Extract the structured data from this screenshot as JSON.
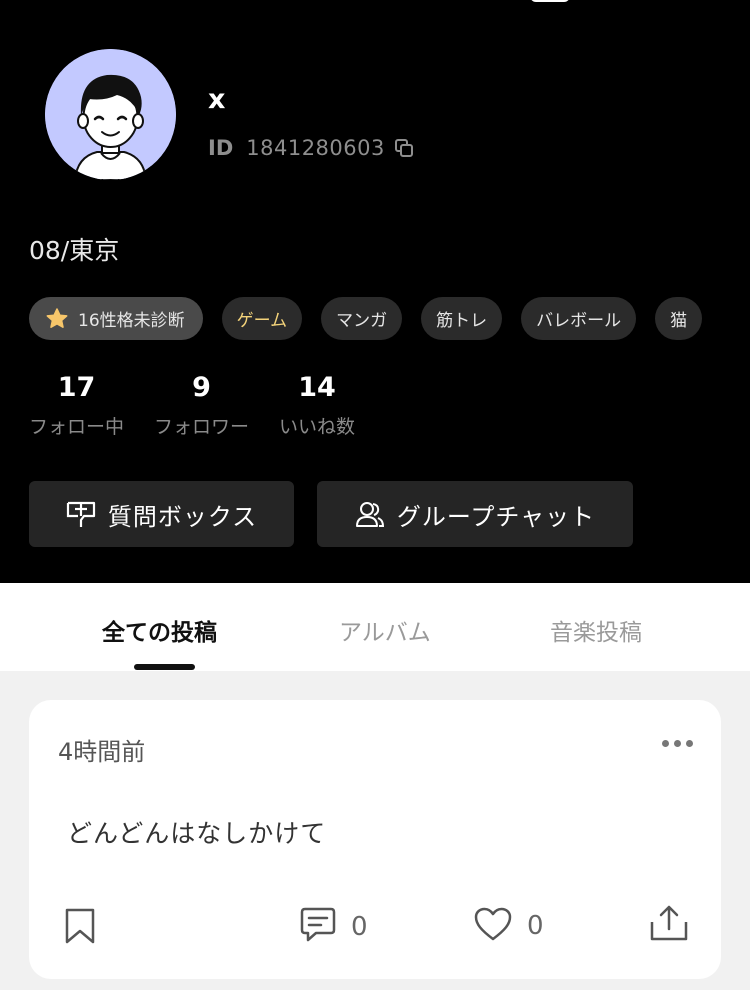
{
  "profile": {
    "username": "x",
    "id_label": "ID",
    "id_number": "1841280603",
    "bio": "08/東京",
    "tags": [
      {
        "label": "16性格未診断"
      },
      {
        "label": "ゲーム"
      },
      {
        "label": "マンガ"
      },
      {
        "label": "筋トレ"
      },
      {
        "label": "バレボール"
      },
      {
        "label": "猫"
      }
    ],
    "stats": [
      {
        "value": "17",
        "label": "フォロー中"
      },
      {
        "value": "9",
        "label": "フォロワー"
      },
      {
        "value": "14",
        "label": "いいね数"
      }
    ],
    "actions": {
      "question_box": "質問ボックス",
      "group_chat": "グループチャット"
    }
  },
  "tabs": [
    {
      "label": "全ての投稿",
      "active": true
    },
    {
      "label": "アルバム",
      "active": false
    },
    {
      "label": "音楽投稿",
      "active": false
    }
  ],
  "post": {
    "time": "4時間前",
    "text": "どんどんはなしかけて",
    "comment_count": "0",
    "like_count": "0"
  },
  "colors": {
    "profile_bg": "#000000",
    "avatar_bg": "#c3c9ff",
    "game_tag_text": "#f3d37a",
    "star": "#f7c66a"
  },
  "icons": [
    "copy-icon",
    "star-icon",
    "question-box-icon",
    "group-icon",
    "more-icon",
    "bookmark-icon",
    "comment-icon",
    "heart-icon",
    "share-icon"
  ]
}
